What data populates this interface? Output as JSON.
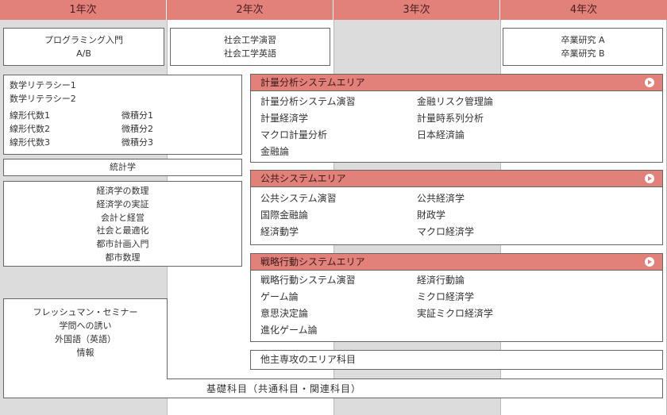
{
  "years": [
    "1年次",
    "2年次",
    "3年次",
    "4年次"
  ],
  "intro": {
    "line1": "プログラミング入門",
    "line2": "A/B"
  },
  "social": {
    "line1": "社会工学演習",
    "line2": "社会工学英語"
  },
  "grad": {
    "line1": "卒業研究 A",
    "line2": "卒業研究 B"
  },
  "math": {
    "lit1": "数学リテラシー1",
    "lit2": "数学リテラシー2",
    "rows": [
      [
        "線形代数1",
        "微積分1"
      ],
      [
        "線形代数2",
        "微積分2"
      ],
      [
        "線形代数3",
        "微積分3"
      ]
    ]
  },
  "stats": "統計学",
  "econ": [
    "経済学の数理",
    "経済学の実証",
    "会計と経営",
    "社会と最適化",
    "都市計画入門",
    "都市数理"
  ],
  "freshman": [
    "フレッシュマン・セミナー",
    "学問への誘い",
    "外国語（英語）",
    "情報"
  ],
  "areas": [
    {
      "title": "計量分析システムエリア",
      "left": [
        "計量分析システム演習",
        "計量経済学",
        "マクロ計量分析",
        "金融論"
      ],
      "right": [
        "金融リスク管理論",
        "計量時系列分析",
        "日本経済論"
      ]
    },
    {
      "title": "公共システムエリア",
      "left": [
        "公共システム演習",
        "国際金融論",
        "経済動学"
      ],
      "right": [
        "公共経済学",
        "財政学",
        "マクロ経済学"
      ]
    },
    {
      "title": "戦略行動システムエリア",
      "left": [
        "戦略行動システム演習",
        "ゲーム論",
        "意思決定論",
        "進化ゲーム論"
      ],
      "right": [
        "経済行動論",
        "ミクロ経済学",
        "実証ミクロ経済学"
      ]
    }
  ],
  "other": "他主専攻のエリア科目",
  "basic": "基礎科目（共通科目・関連科目）",
  "colors": {
    "header": "#e2807a",
    "column_shade": "#dcdcdc",
    "border": "#666666"
  }
}
